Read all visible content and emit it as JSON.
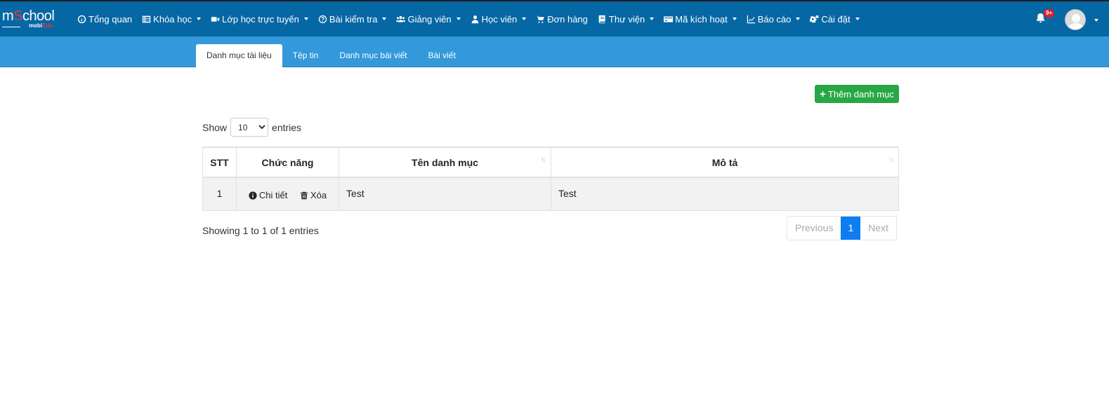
{
  "logo": {
    "main_prefix": "m",
    "main_accent": "S",
    "main_suffix": "chool",
    "sub_prefix": "mobi",
    "sub_accent": "Edu"
  },
  "nav": [
    {
      "label": "Tổng quan",
      "icon": "dashboard-icon",
      "dropdown": false
    },
    {
      "label": "Khóa học",
      "icon": "list-icon",
      "dropdown": true
    },
    {
      "label": "Lớp học trực tuyến",
      "icon": "video-icon",
      "dropdown": true
    },
    {
      "label": "Bài kiểm tra",
      "icon": "question-circle-icon",
      "dropdown": true
    },
    {
      "label": "Giảng viên",
      "icon": "users-icon",
      "dropdown": true
    },
    {
      "label": "Học viên",
      "icon": "user-icon",
      "dropdown": true
    },
    {
      "label": "Đơn hàng",
      "icon": "cart-icon",
      "dropdown": false
    },
    {
      "label": "Thư viện",
      "icon": "book-icon",
      "dropdown": true
    },
    {
      "label": "Mã kích hoạt",
      "icon": "credit-card-icon",
      "dropdown": true
    },
    {
      "label": "Báo cáo",
      "icon": "line-chart-icon",
      "dropdown": true
    },
    {
      "label": "Cài đặt",
      "icon": "cogs-icon",
      "dropdown": true
    }
  ],
  "notifications": {
    "badge": "9+"
  },
  "tabs": [
    {
      "label": "Danh mục tài liệu",
      "active": true
    },
    {
      "label": "Tệp tin",
      "active": false
    },
    {
      "label": "Danh mục bài viết",
      "active": false
    },
    {
      "label": "Bài viết",
      "active": false
    }
  ],
  "add_button": {
    "label": "Thêm danh mục"
  },
  "length": {
    "prefix": "Show",
    "value": "10",
    "suffix": "entries"
  },
  "table": {
    "headers": [
      "STT",
      "Chức năng",
      "Tên danh mục",
      "Mô tả"
    ],
    "rows": [
      {
        "stt": "1",
        "detail": "Chi tiết",
        "delete": "Xóa",
        "name": "Test",
        "desc": "Test"
      }
    ]
  },
  "info": "Showing 1 to 1 of 1 entries",
  "pagination": {
    "previous": "Previous",
    "current": "1",
    "next": "Next"
  },
  "colors": {
    "topbar": "#0567a4",
    "subbar": "#3399da",
    "add_button": "#28a745",
    "active_page": "#0d7df0",
    "badge": "#dc1e2d"
  }
}
